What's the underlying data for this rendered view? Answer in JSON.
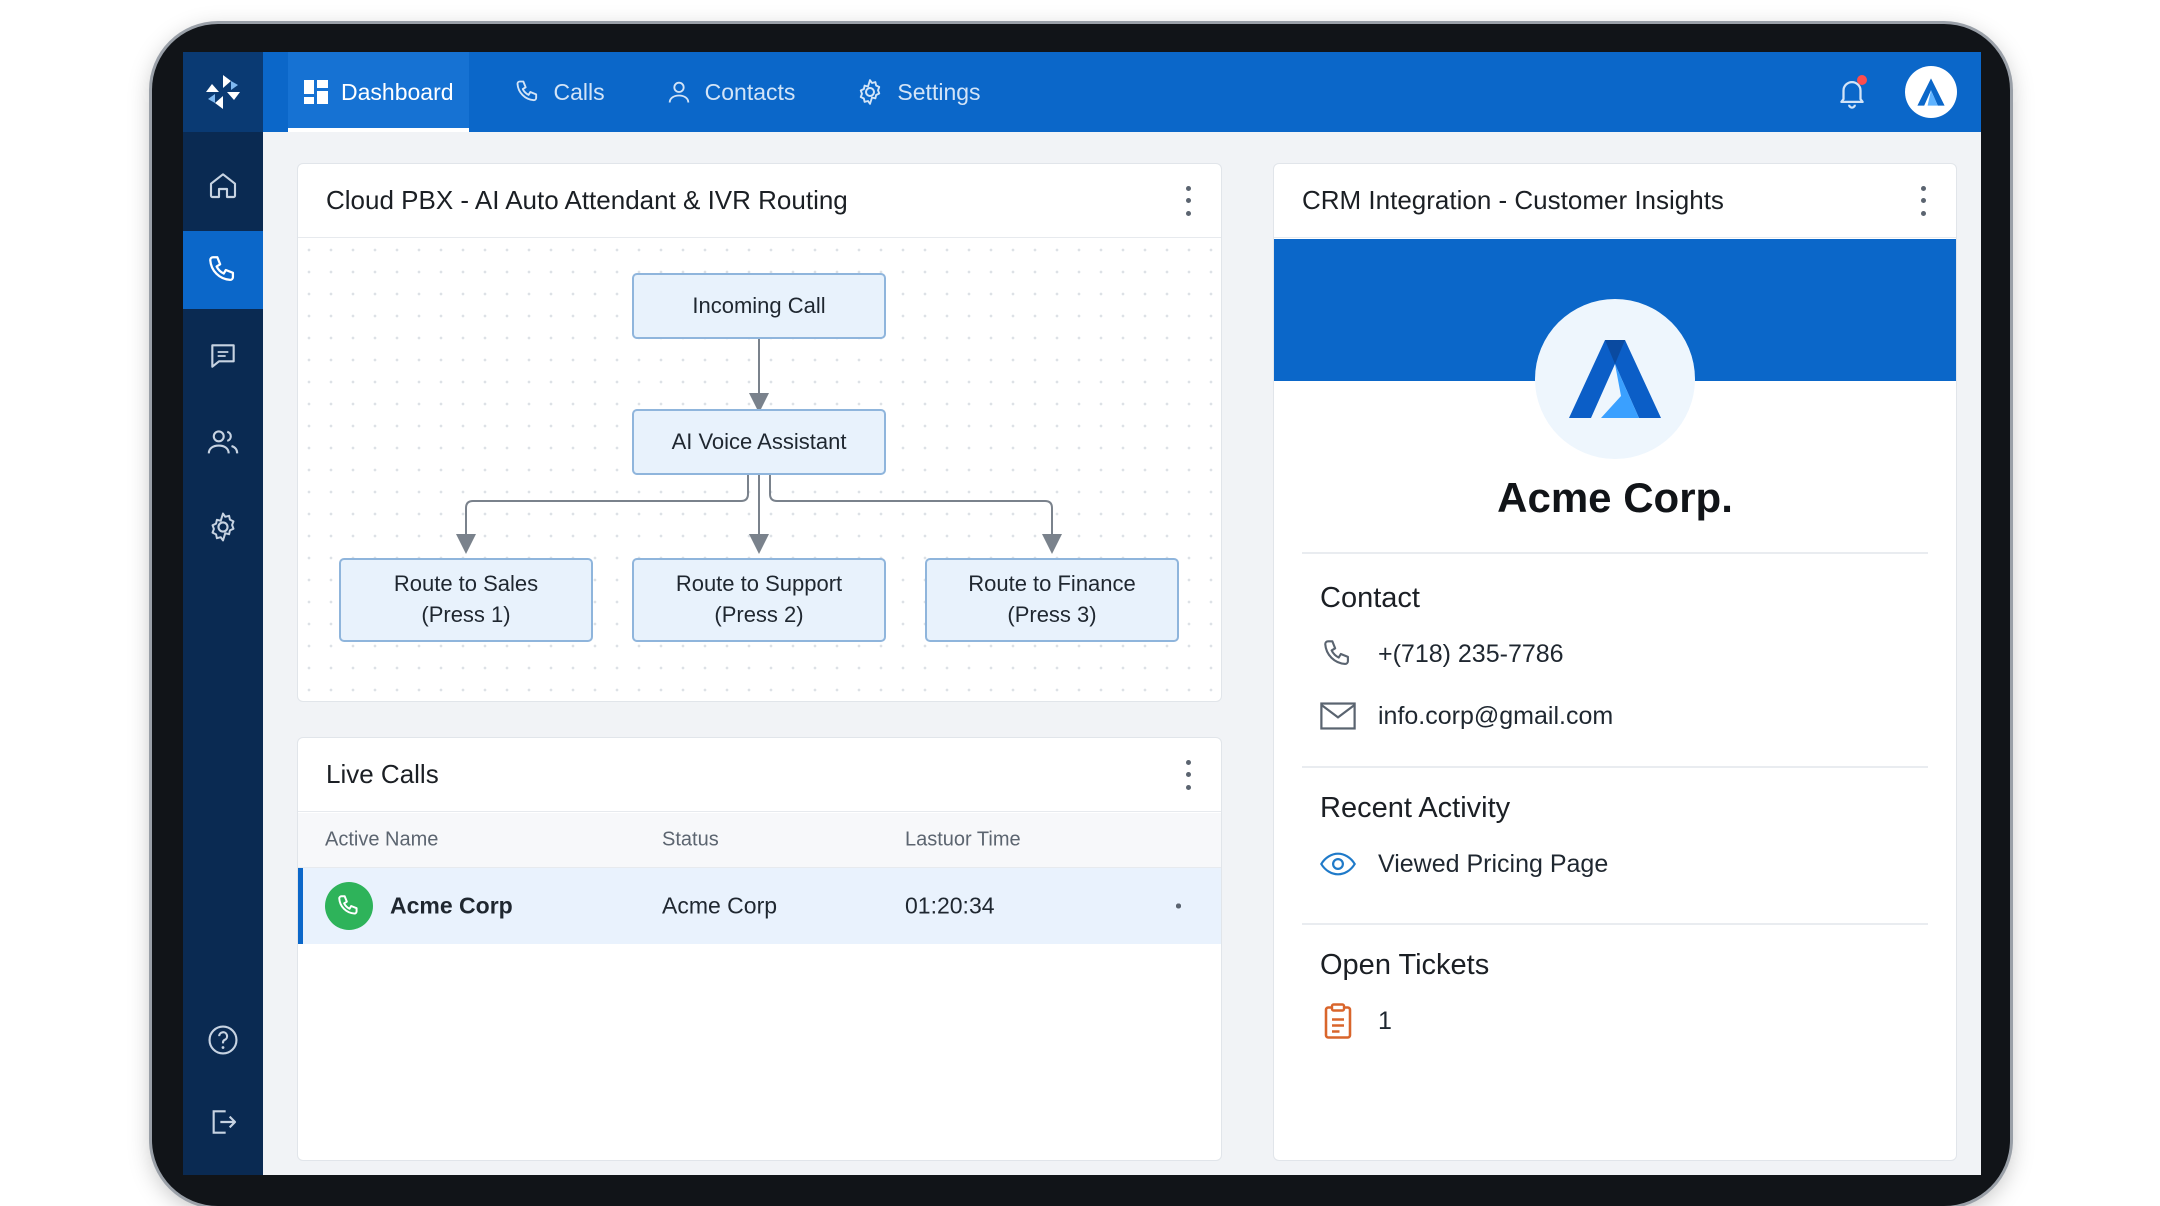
{
  "nav": {
    "items": [
      {
        "label": "Dashboard",
        "icon": "dashboard-icon"
      },
      {
        "label": "Calls",
        "icon": "phone-icon"
      },
      {
        "label": "Contacts",
        "icon": "user-icon"
      },
      {
        "label": "Settings",
        "icon": "gear-icon"
      }
    ],
    "active": "Dashboard"
  },
  "user": {
    "avatar_letter": "A",
    "notifications": true
  },
  "sidebar": {
    "items": [
      "home-icon",
      "phone-icon",
      "chat-icon",
      "users-icon",
      "gear-icon",
      "help-icon",
      "logout-icon"
    ],
    "active": "phone-icon"
  },
  "pbx": {
    "title": "Cloud PBX - AI Auto Attendant & IVR Routing",
    "nodes": {
      "incoming": "Incoming Call",
      "assistant": "AI Voice Assistant",
      "sales_line1": "Route to Sales",
      "sales_line2": "(Press 1)",
      "support_line1": "Route to Support",
      "support_line2": "(Press 2)",
      "finance_line1": "Route to Finance",
      "finance_line2": "(Press 3)"
    }
  },
  "live_calls": {
    "title": "Live Calls",
    "columns": [
      "Active Name",
      "Status",
      "Lastuor Time"
    ],
    "rows": [
      {
        "name": "Acme Corp",
        "status": "Acme Corp",
        "time": "01:20:34"
      }
    ]
  },
  "crm": {
    "title": "CRM Integration - Customer Insights",
    "company": "Acme Corp.",
    "logo_letter": "A",
    "contact_title": "Contact",
    "phone": "+(718) 235-7786",
    "email": "info.corp@gmail.com",
    "activity_title": "Recent Activity",
    "activity": "Viewed Pricing Page",
    "tickets_title": "Open Tickets",
    "tickets_count": "1"
  },
  "colors": {
    "brand_blue": "#0b67c9",
    "sidebar_navy": "#0a2a52",
    "call_green": "#2eb35a",
    "ticket_orange": "#d9652b"
  }
}
